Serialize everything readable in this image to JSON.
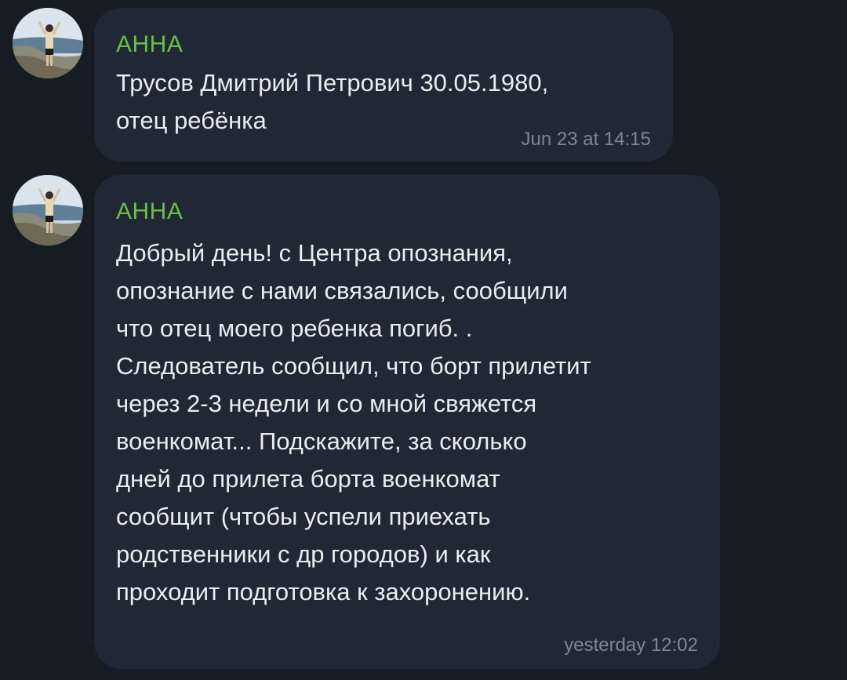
{
  "colors": {
    "background": "#151c24",
    "bubble": "#1f2834",
    "sender_name": "#6abf4b",
    "message_text": "#e9edf1",
    "timestamp": "#7d8894"
  },
  "messages": [
    {
      "sender": "АННА",
      "avatar_icon": "user-photo-avatar",
      "text": "Трусов Дмитрий Петрович 30.05.1980,\nотец ребёнка",
      "time": "Jun 23 at 14:15"
    },
    {
      "sender": "АННА",
      "avatar_icon": "user-photo-avatar",
      "text": "Добрый день!  с Центра опознания,\nопознание с нами связались, сообщили\nчто отец моего ребенка погиб. .\nСледователь сообщил, что борт прилетит\nчерез 2-3 недели и со мной свяжется\nвоенкомат... Подскажите, за сколько\nдней до прилета борта военкомат\nсообщит  (чтобы успели приехать\nродственники с др городов) и как\nпроходит подготовка к захоронению.",
      "time": "yesterday 12:02"
    }
  ]
}
